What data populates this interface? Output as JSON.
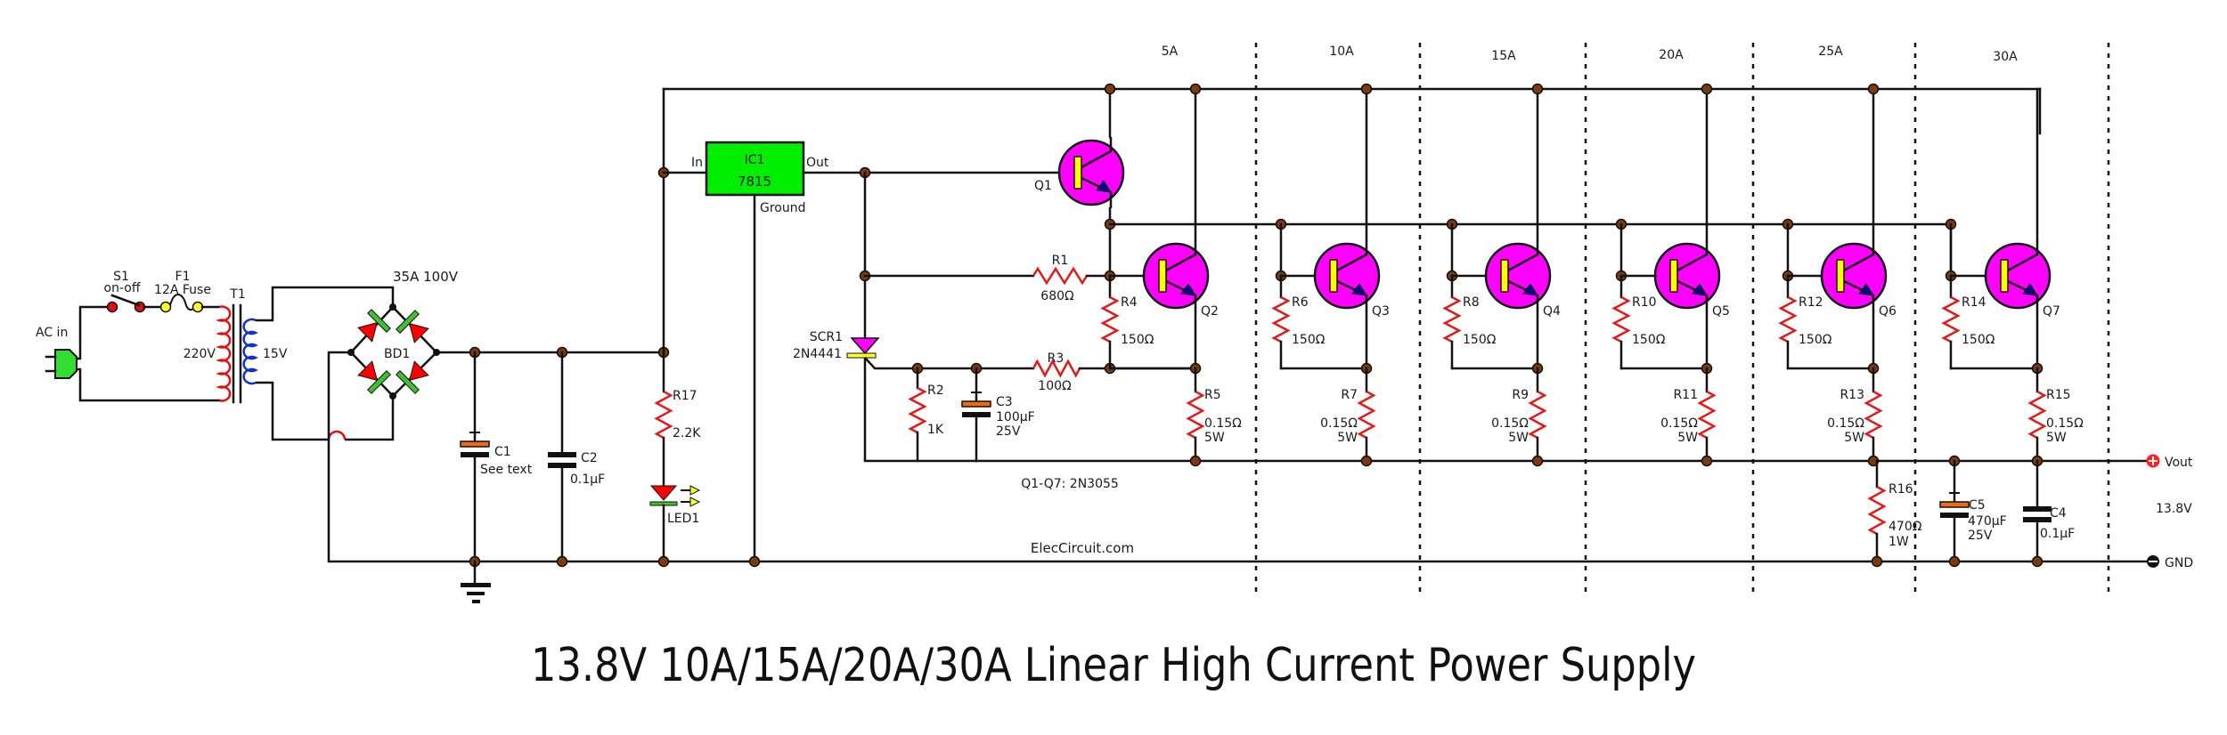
{
  "title": "13.8V 10A/15A/20A/30A Linear High Current Power Supply",
  "watermark": "ElecCircuit.com",
  "transistor_note": "Q1-Q7: 2N3055",
  "colors": {
    "wire": "#111111",
    "node": "#7a3a0c",
    "resistor": "#e11a1a",
    "transistor_body": "#ff00ff",
    "transistor_base_bar": "#ffff00",
    "emitter_arrow": "#0a0a80",
    "ic_body": "#00ee00",
    "cap_positive_plate": "#f06a10",
    "diode_body": "#ff0000",
    "diode_bar": "#40c030",
    "primary_winding": "#e01010",
    "secondary_winding": "#1030d0",
    "plug": "#33dd33",
    "scr_body": "#ff00ff",
    "vout_terminal": "#ff2020",
    "gnd_terminal": "#111111"
  },
  "input": {
    "ac_label": "AC in",
    "switch": {
      "ref": "S1",
      "desc": "on-off"
    },
    "fuse": {
      "ref": "F1",
      "desc": "12A Fuse"
    },
    "transformer": {
      "ref": "T1",
      "primary": "220V",
      "secondary": "15V"
    },
    "bridge": {
      "ref": "BD1",
      "rating": "35A 100V"
    }
  },
  "filter": {
    "c1": {
      "ref": "C1",
      "value": "See text"
    },
    "c2": {
      "ref": "C2",
      "value": "0.1µF"
    },
    "r17": {
      "ref": "R17",
      "value": "2.2K"
    },
    "led": {
      "ref": "LED1"
    }
  },
  "regulator": {
    "ref": "IC1",
    "part": "7815",
    "pin_in": "In",
    "pin_out": "Out",
    "pin_gnd": "Ground"
  },
  "protection": {
    "scr": {
      "ref": "SCR1",
      "part": "2N4441"
    },
    "r1": {
      "ref": "R1",
      "value": "680Ω"
    },
    "r2": {
      "ref": "R2",
      "value": "1K"
    },
    "r3": {
      "ref": "R3",
      "value": "100Ω"
    },
    "c3": {
      "ref": "C3",
      "value": "100µF",
      "voltage": "25V"
    }
  },
  "stages": [
    {
      "current": "5A",
      "transistor": "Q2",
      "base_r": {
        "ref": "R4",
        "value": "150Ω"
      },
      "emitter_r": {
        "ref": "R5",
        "value": "0.15Ω",
        "power": "5W"
      }
    },
    {
      "current": "10A",
      "transistor": "Q3",
      "base_r": {
        "ref": "R6",
        "value": "150Ω"
      },
      "emitter_r": {
        "ref": "R7",
        "value": "0.15Ω",
        "power": "5W"
      }
    },
    {
      "current": "15A",
      "transistor": "Q4",
      "base_r": {
        "ref": "R8",
        "value": "150Ω"
      },
      "emitter_r": {
        "ref": "R9",
        "value": "0.15Ω",
        "power": "5W"
      }
    },
    {
      "current": "20A",
      "transistor": "Q5",
      "base_r": {
        "ref": "R10",
        "value": "150Ω"
      },
      "emitter_r": {
        "ref": "R11",
        "value": "0.15Ω",
        "power": "5W"
      }
    },
    {
      "current": "25A",
      "transistor": "Q6",
      "base_r": {
        "ref": "R12",
        "value": "150Ω"
      },
      "emitter_r": {
        "ref": "R13",
        "value": "0.15Ω",
        "power": "5W"
      }
    },
    {
      "current": "30A",
      "transistor": "Q7",
      "base_r": {
        "ref": "R14",
        "value": "150Ω"
      },
      "emitter_r": {
        "ref": "R15",
        "value": "0.15Ω",
        "power": "5W"
      }
    }
  ],
  "driver": {
    "transistor": "Q1"
  },
  "output": {
    "r16": {
      "ref": "R16",
      "value": "470Ω",
      "power": "1W"
    },
    "c5": {
      "ref": "C5",
      "value": "470µF",
      "voltage": "25V"
    },
    "c4": {
      "ref": "C4",
      "value": "0.1µF"
    },
    "vout_label": "Vout",
    "gnd_label": "GND",
    "voltage": "13.8V"
  }
}
